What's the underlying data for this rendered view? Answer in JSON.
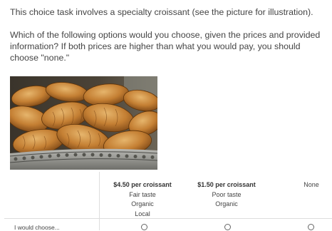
{
  "intro": "This choice task involves a specialty croissant (see the picture for illustration).",
  "question": "Which of the following options would you choose, given the prices and provided information? If both prices are higher than what you would pay, you should choose \"none.\"",
  "options": [
    {
      "price": "$4.50 per croissant",
      "attrs": [
        "Fair taste",
        "Organic",
        "Local"
      ]
    },
    {
      "price": "$1.50 per croissant",
      "attrs": [
        "Poor taste",
        "Organic"
      ]
    },
    {
      "price": "",
      "attrs": [
        "None"
      ]
    }
  ],
  "row_label": "I would choose...",
  "icons": {
    "radio": "radio-button-icon",
    "photo": "croissant-photo"
  }
}
